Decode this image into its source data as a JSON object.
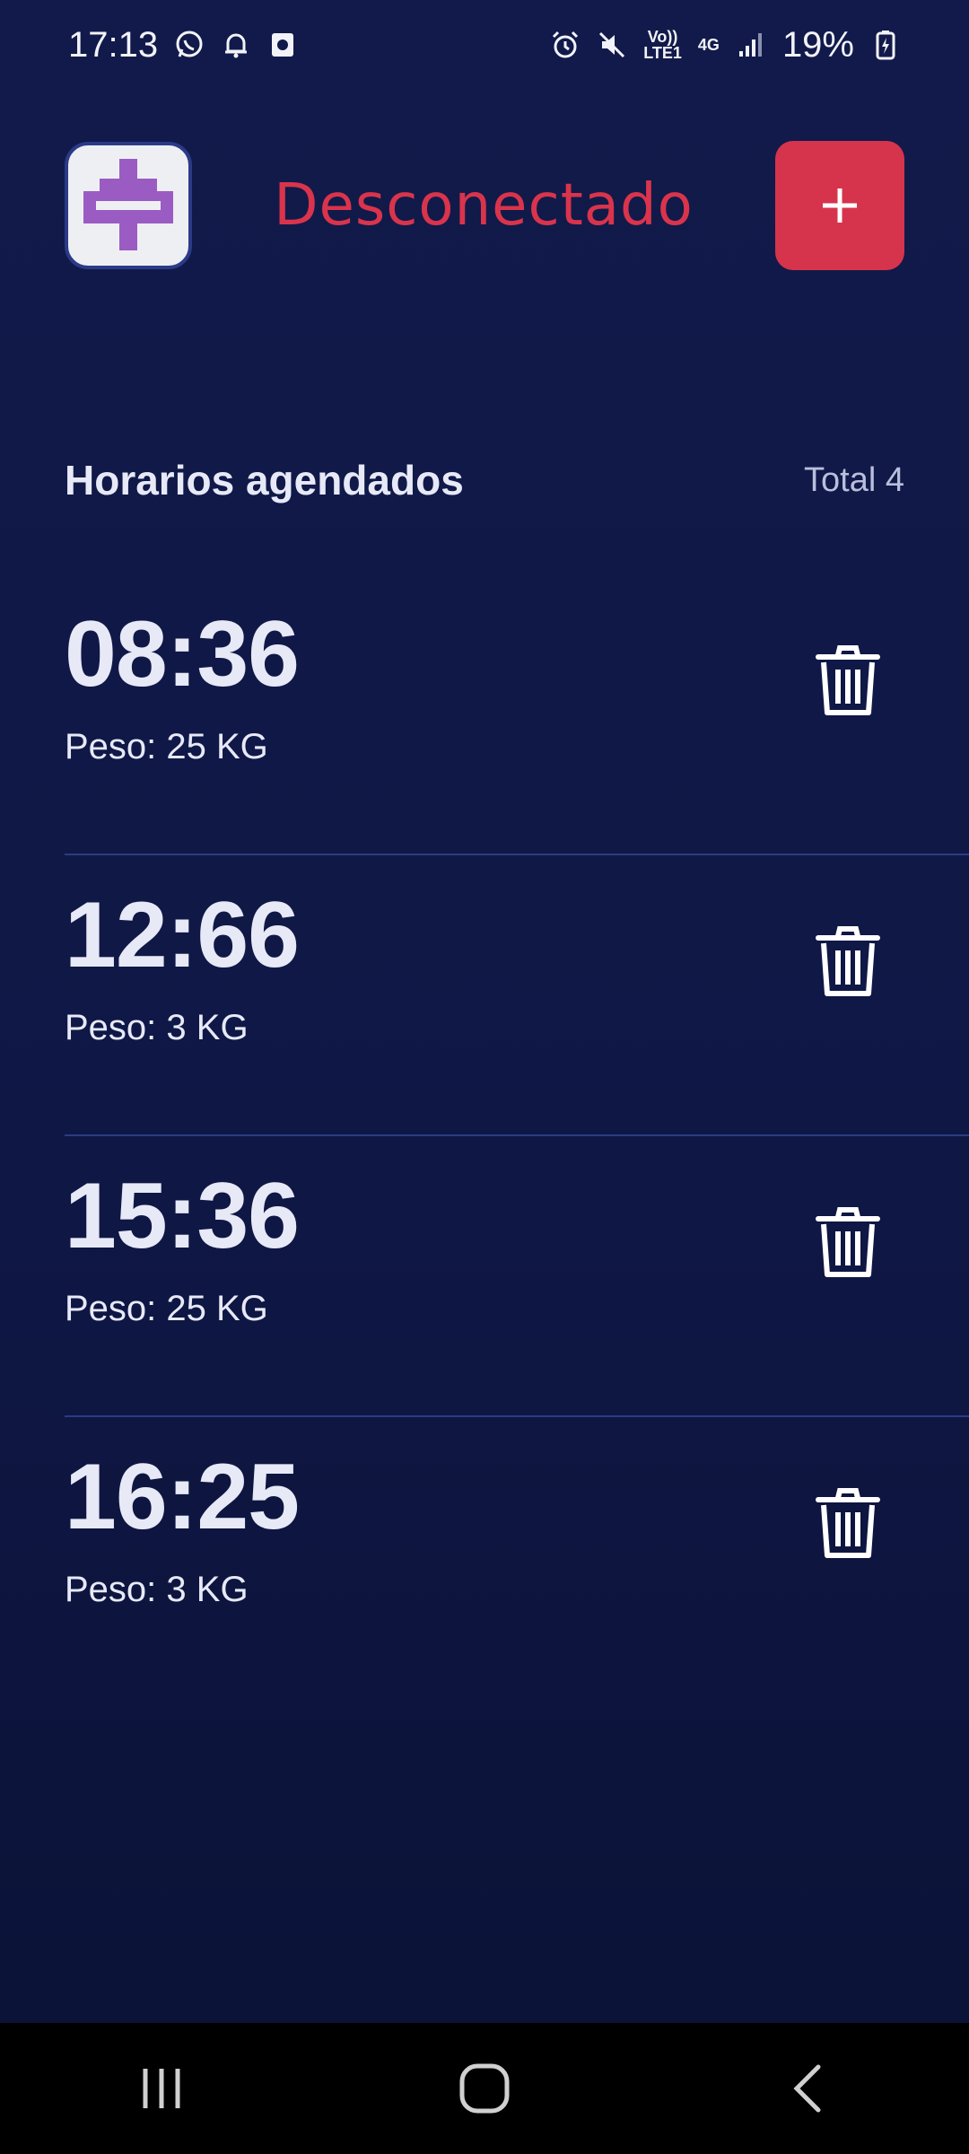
{
  "status_bar": {
    "time": "17:13",
    "network_top": "Vo))",
    "network_bottom": "LTE1",
    "data_type": "4G",
    "battery": "19%"
  },
  "header": {
    "connection_status": "Desconectado",
    "add_label": "+"
  },
  "list": {
    "title": "Horarios agendados",
    "total": "Total 4",
    "items": [
      {
        "time": "08:36",
        "weight": "Peso: 25 KG"
      },
      {
        "time": "12:66",
        "weight": "Peso: 3 KG"
      },
      {
        "time": "15:36",
        "weight": "Peso: 25 KG"
      },
      {
        "time": "16:25",
        "weight": "Peso: 3 KG"
      }
    ]
  },
  "icons": {
    "status_left": [
      "whatsapp-icon",
      "bell-icon",
      "camera-icon"
    ],
    "status_right": [
      "alarm-icon",
      "mute-icon",
      "signal-icon",
      "battery-icon"
    ],
    "row_action": "trash-icon",
    "nav": [
      "recent-apps-icon",
      "home-icon",
      "back-icon"
    ]
  },
  "colors": {
    "background": "#111a4a",
    "accent_red": "#d6344c",
    "divider": "#2b3c86",
    "logo_purple": "#9a5cc2"
  }
}
